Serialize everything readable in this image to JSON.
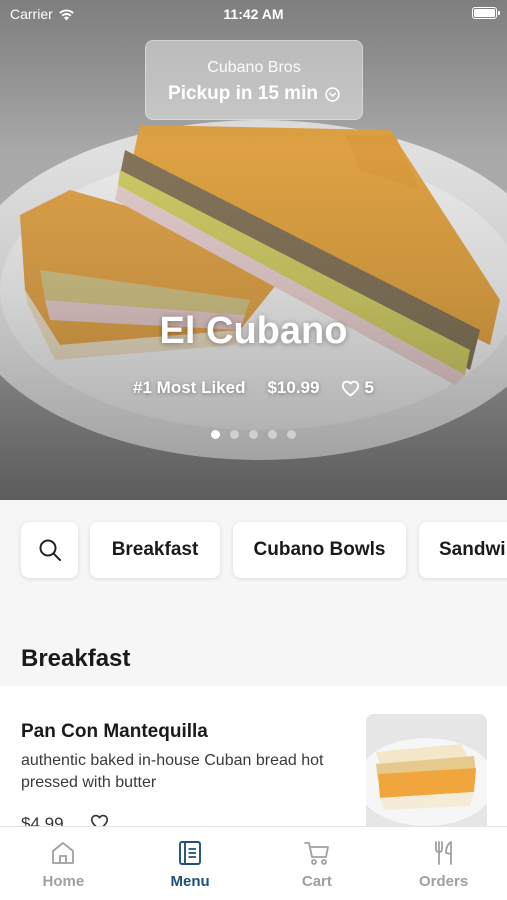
{
  "status_bar": {
    "carrier": "Carrier",
    "time": "11:42 AM"
  },
  "pickup": {
    "store": "Cubano Bros",
    "time_label": "Pickup in 15 min"
  },
  "hero": {
    "title": "El Cubano",
    "rank": "#1 Most Liked",
    "price": "$10.99",
    "likes": "5",
    "slide_count": 5,
    "active_slide": 1
  },
  "categories": [
    "Breakfast",
    "Cubano Bowls",
    "Sandwi"
  ],
  "section": {
    "title": "Breakfast"
  },
  "item": {
    "name": "Pan Con Mantequilla",
    "description": "authentic baked in-house Cuban bread hot pressed with butter",
    "price": "$4.99"
  },
  "tabs": [
    {
      "label": "Home",
      "icon": "home-icon"
    },
    {
      "label": "Menu",
      "icon": "menu-book-icon",
      "active": true
    },
    {
      "label": "Cart",
      "icon": "cart-icon"
    },
    {
      "label": "Orders",
      "icon": "fork-knife-icon"
    }
  ],
  "colors": {
    "accent": "#1f4f7a",
    "inactive_tab": "#a0a0a0"
  }
}
